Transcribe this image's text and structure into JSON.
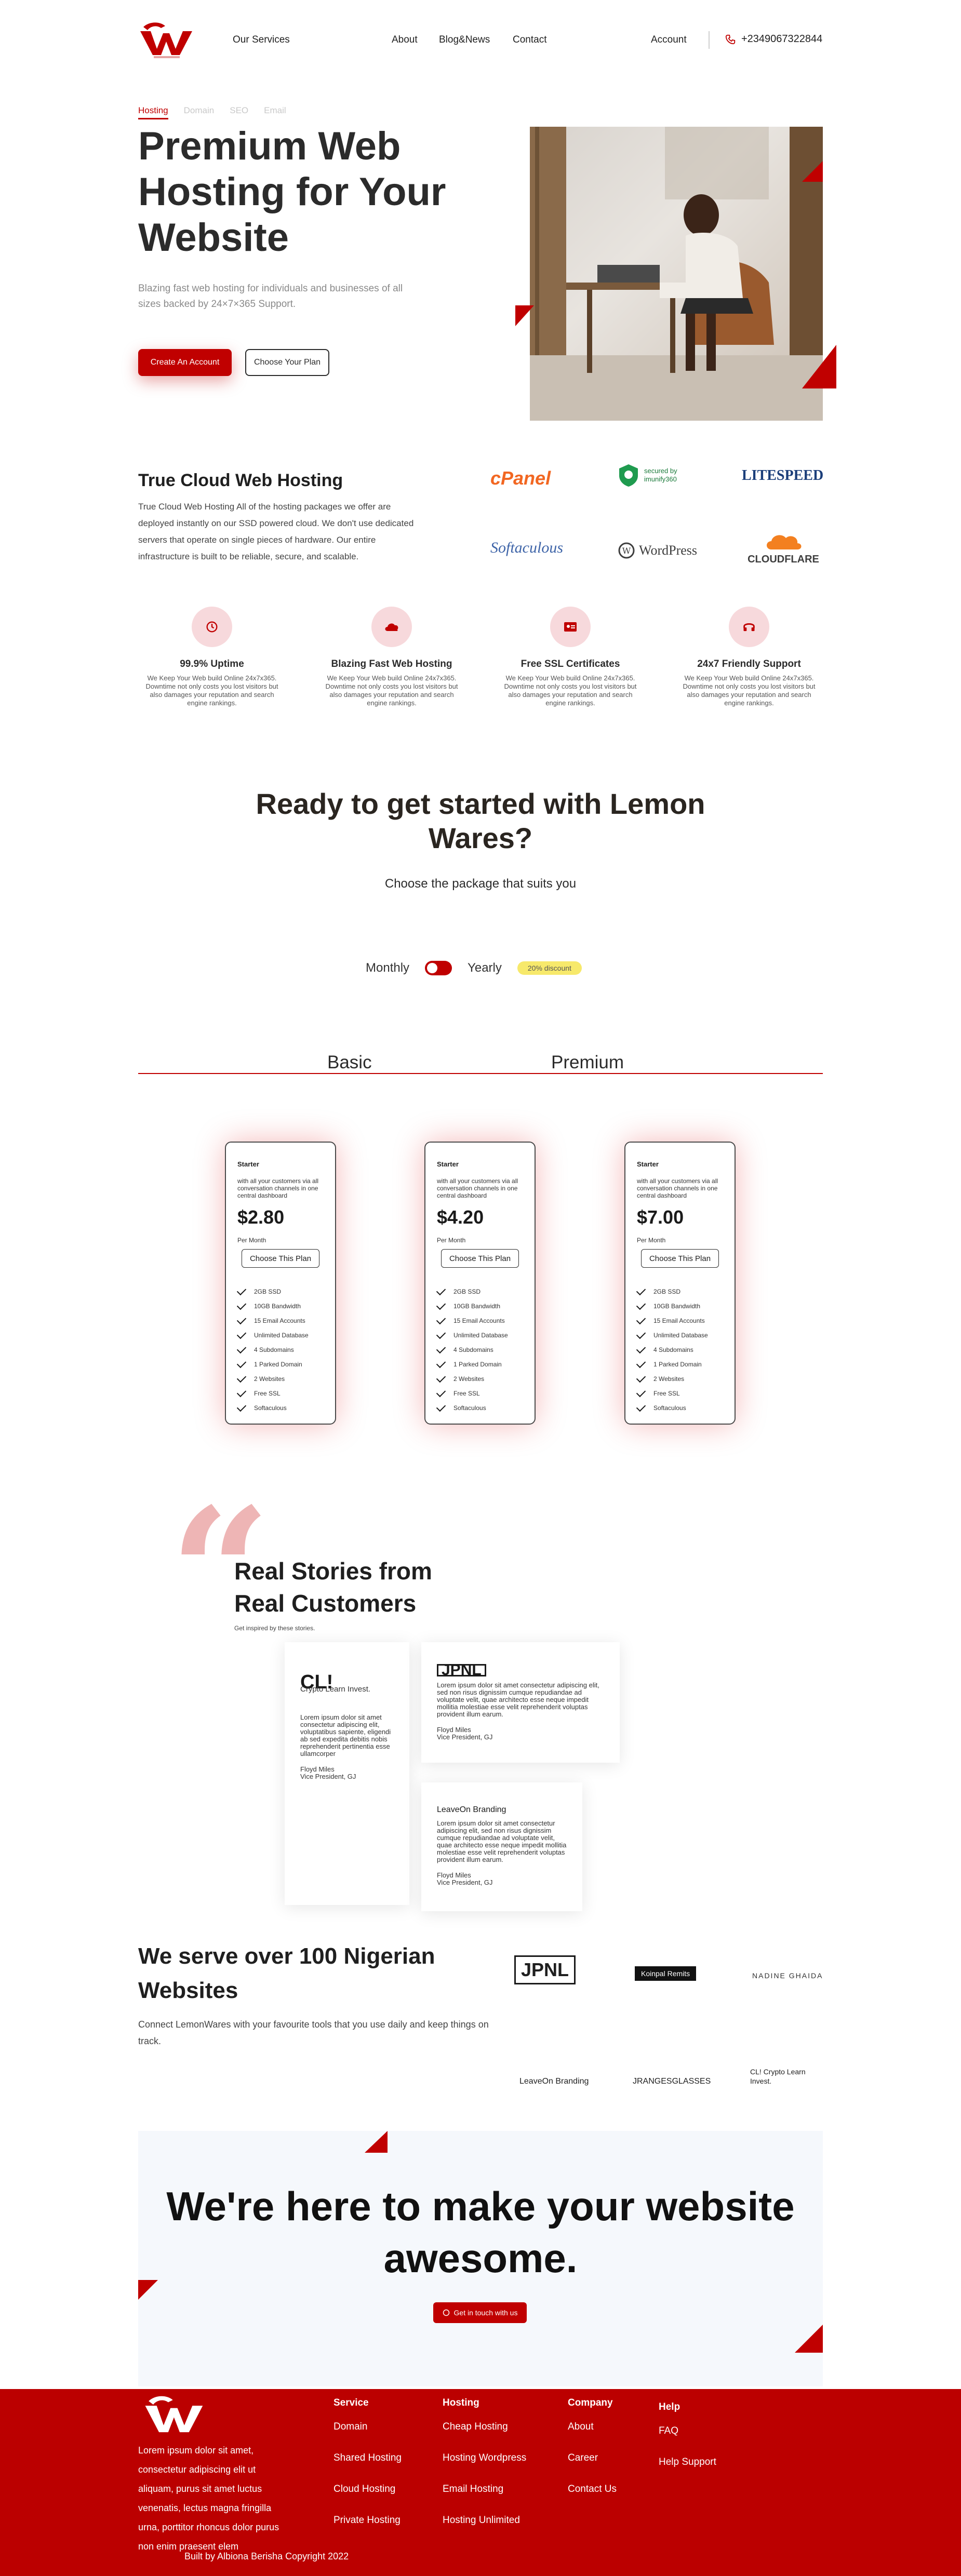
{
  "colors": {
    "brand_red": "#c00000",
    "footer_red": "#bb0000",
    "discount_yellow": "#f7e96b",
    "cta_bg": "#f5f8fc"
  },
  "nav": {
    "services": "Our Services",
    "about": "About",
    "blog": "Blog&News",
    "contact": "Contact",
    "account": "Account",
    "phone": "+2349067322844"
  },
  "hero": {
    "tabs": [
      "Hosting",
      "Domain",
      "SEO",
      "Email"
    ],
    "title": "Premium Web Hosting for Your Website",
    "subtitle": "Blazing fast web hosting for individuals and businesses of all sizes backed by 24×7×365 Support.",
    "primary_btn": "Create An Account",
    "secondary_btn": "Choose Your Plan"
  },
  "cloud": {
    "title": "True Cloud Web Hosting",
    "text": "True Cloud Web Hosting All of the hosting packages we offer are deployed instantly on our SSD powered cloud. We don't use dedicated servers that operate on single pieces of hardware. Our entire infrastructure is built to be reliable, secure, and scalable.",
    "brands": [
      "cPanel",
      "secured by imunify360",
      "LITESPEED",
      "Softaculous",
      "WordPress",
      "CLOUDFLARE"
    ]
  },
  "features": [
    {
      "title": "99.9% Uptime",
      "text": "We Keep Your Web build Online 24x7x365. Downtime not only costs you lost visitors but also damages your reputation and search engine rankings.",
      "icon": "clock-history-icon"
    },
    {
      "title": "Blazing Fast Web Hosting",
      "text": "We Keep Your Web build Online 24x7x365. Downtime not only costs you lost visitors but also damages your reputation and search engine rankings.",
      "icon": "cloud-icon"
    },
    {
      "title": "Free SSL Certificates",
      "text": "We Keep Your Web build Online 24x7x365. Downtime not only costs you lost visitors but also damages your reputation and search engine rankings.",
      "icon": "certificate-icon"
    },
    {
      "title": "24x7 Friendly Support",
      "text": "We Keep Your Web build Online 24x7x365. Downtime not only costs you lost visitors but also damages your reputation and search engine rankings.",
      "icon": "headset-icon"
    }
  ],
  "pricing": {
    "title": "Ready to get started with Lemon Wares?",
    "subtitle": "Choose the package that suits you",
    "monthly": "Monthly",
    "yearly": "Yearly",
    "discount": "20% discount",
    "plan_tabs": [
      "Basic",
      "Premium"
    ],
    "cards": [
      {
        "name": "Starter",
        "desc": "with all your customers via all conversation channels in one central dashboard",
        "price": "$2.80",
        "per": "Per Month",
        "btn": "Choose This Plan"
      },
      {
        "name": "Starter",
        "desc": "with all your customers via all conversation channels in one central dashboard",
        "price": "$4.20",
        "per": "Per Month",
        "btn": "Choose This Plan"
      },
      {
        "name": "Starter",
        "desc": "with all your customers via all conversation channels in one central dashboard",
        "price": "$7.00",
        "per": "Per Month",
        "btn": "Choose This Plan"
      }
    ],
    "features": [
      "2GB SSD",
      "10GB Bandwidth",
      "15 Email Accounts",
      "Unlimited Database",
      "4 Subdomains",
      "1 Parked Domain",
      "2 Websites",
      "Free SSL",
      "Softaculous"
    ]
  },
  "stories": {
    "title": "Real Stories from Real Customers",
    "subtitle": "Get inspired by these stories.",
    "cards": [
      {
        "logo": "CL!",
        "logo_sub": "Crypto Learn Invest.",
        "text": "Lorem ipsum dolor sit amet consectetur adipiscing elit, voluptatibus sapiente, eligendi ab sed expedita debitis nobis reprehenderit pertinentia esse ullamcorper",
        "name": "Floyd Miles",
        "role": "Vice President, GJ"
      },
      {
        "logo": "JPNL",
        "logo_sub": "",
        "text": "Lorem ipsum dolor sit amet consectetur adipiscing elit, sed non risus dignissim cumque repudiandae ad voluptate velit, quae architecto esse neque impedit mollitia molestiae esse velit reprehenderit voluptas provident illum earum.",
        "name": "Floyd Miles",
        "role": "Vice President, GJ"
      },
      {
        "logo": "LeaveOn Branding",
        "logo_sub": "",
        "text": "Lorem ipsum dolor sit amet consectetur adipiscing elit, sed non risus dignissim cumque repudiandae ad voluptate velit, quae architecto esse neque impedit mollitia molestiae esse velit reprehenderit voluptas provident illum earum.",
        "name": "Floyd Miles",
        "role": "Vice President, GJ"
      }
    ]
  },
  "serve": {
    "title": "We serve over 100 Nigerian Websites",
    "text": "Connect LemonWares with your favourite tools that you use daily and keep things on track.",
    "clients": [
      "JPNL",
      "Koinpal Remits",
      "NADINE GHAIDA",
      "LeaveOn Branding",
      "JRANGESGLASSES",
      "CL! Crypto Learn Invest."
    ]
  },
  "cta": {
    "title": "We're here to make your website awesome.",
    "button": "Get in touch with us"
  },
  "footer": {
    "about": "Lorem ipsum dolor sit amet, consectetur adipiscing elit ut aliquam, purus sit amet luctus venenatis, lectus magna fringilla urna, porttitor rhoncus dolor purus non enim praesent elem",
    "columns": [
      {
        "head": "Service",
        "items": [
          "Domain",
          "Shared Hosting",
          "Cloud Hosting",
          "Private Hosting"
        ]
      },
      {
        "head": "Hosting",
        "items": [
          "Cheap Hosting",
          "Hosting Wordpress",
          "Email Hosting",
          "Hosting Unlimited"
        ]
      },
      {
        "head": "Company",
        "items": [
          "About",
          "Career",
          "Contact Us"
        ]
      },
      {
        "head": "Help",
        "items": [
          "FAQ",
          "Help Support"
        ]
      }
    ],
    "copyright": "Built by Albiona Berisha Copyright 2022"
  }
}
